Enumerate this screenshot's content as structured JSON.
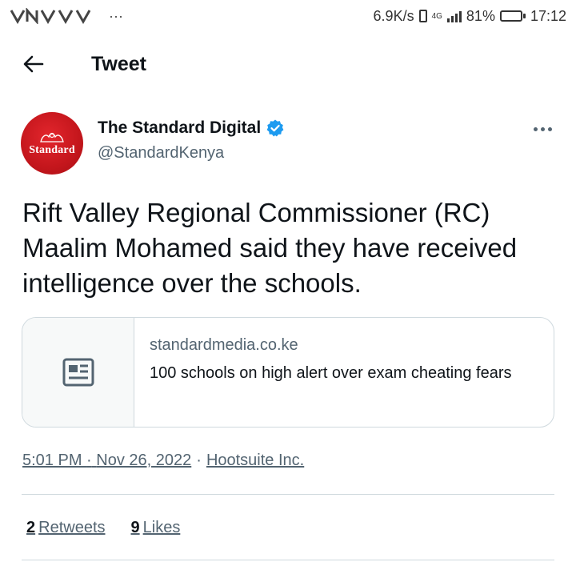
{
  "status_bar": {
    "notification_icons": "˅N˅˅˅",
    "more_glyph": "···",
    "net_speed": "6.9K/s",
    "network_type": "4G",
    "battery_pct": "81%",
    "battery_level": 0.81,
    "time": "17:12"
  },
  "header": {
    "title": "Tweet"
  },
  "author": {
    "name": "The Standard Digital",
    "handle": "@StandardKenya",
    "avatar_text": "Standard",
    "brand_color": "#c4161c",
    "verified_color": "#1d9bf0"
  },
  "tweet": {
    "text": "Rift Valley Regional Commissioner (RC) Maalim Mohamed said they have received intelligence over the schools."
  },
  "card": {
    "domain": "standardmedia.co.ke",
    "title": "100 schools on high alert over exam cheating fears",
    "thumb_icon": "news-article-icon"
  },
  "meta": {
    "time": "5:01 PM",
    "date": "Nov 26, 2022",
    "separator": "·",
    "source": "Hootsuite Inc."
  },
  "stats": {
    "retweets_count": "2",
    "retweets_label": "Retweets",
    "likes_count": "9",
    "likes_label": "Likes"
  }
}
